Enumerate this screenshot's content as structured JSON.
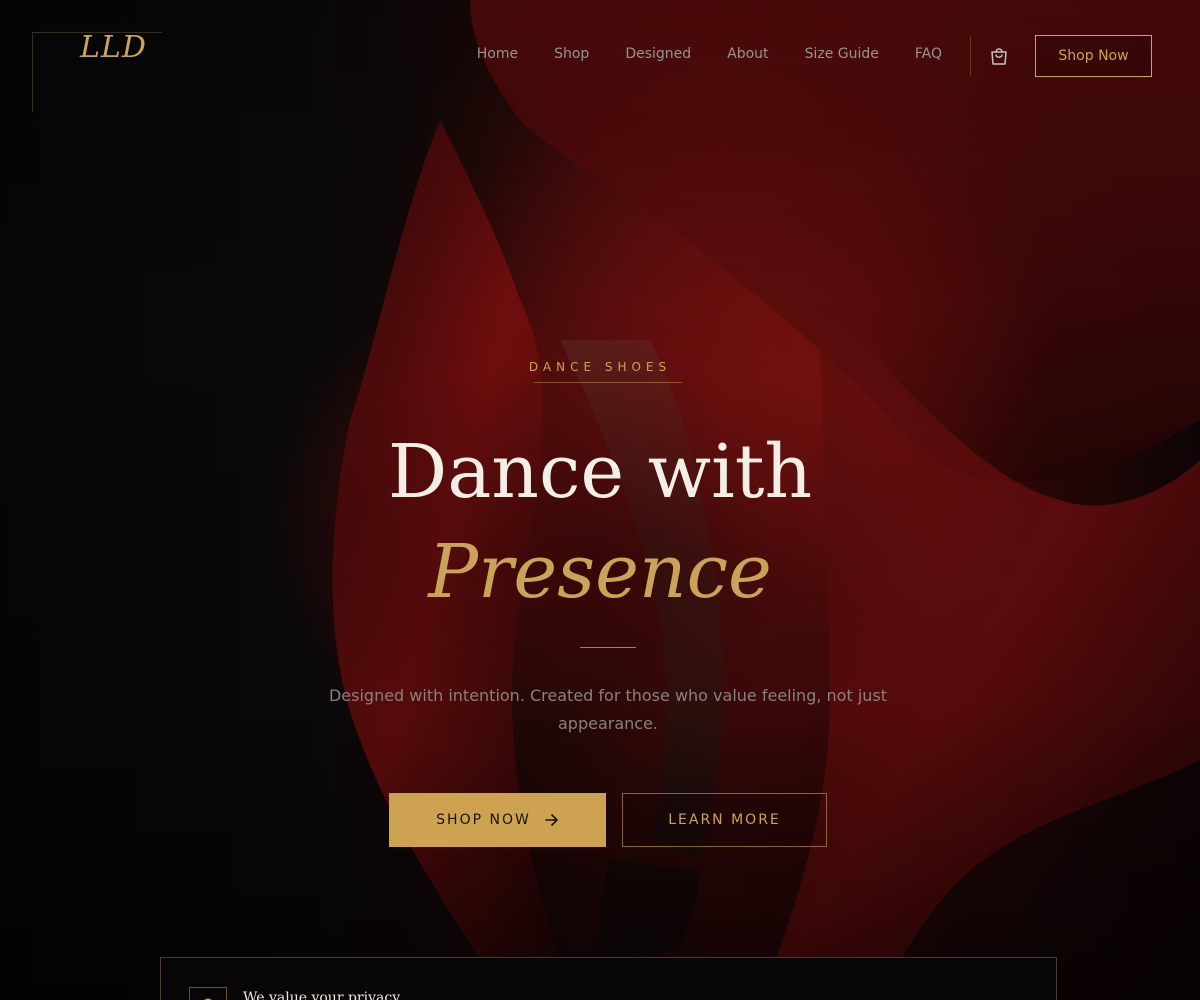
{
  "header": {
    "logo": "LLD",
    "nav": [
      "Home",
      "Shop",
      "Designed",
      "About",
      "Size Guide",
      "FAQ"
    ],
    "cart_icon": "shopping-bag-icon",
    "cta_label": "Shop Now"
  },
  "hero": {
    "eyebrow": "DANCE SHOES",
    "headline": "Dance with",
    "headline_accent": "Presence",
    "subtitle": "Designed with intention. Created for those who value feeling, not just appearance.",
    "primary_button": "SHOP NOW",
    "primary_button_icon": "arrow-right-icon",
    "secondary_button": "LEARN MORE"
  },
  "privacy": {
    "title": "We value your privacy",
    "icon": "shield-icon"
  },
  "colors": {
    "accent_gold": "#c9a458",
    "button_gold": "#cda352",
    "headline": "#f4efe6",
    "background": "#0b0606",
    "fabric_red": "#8c0f10"
  }
}
